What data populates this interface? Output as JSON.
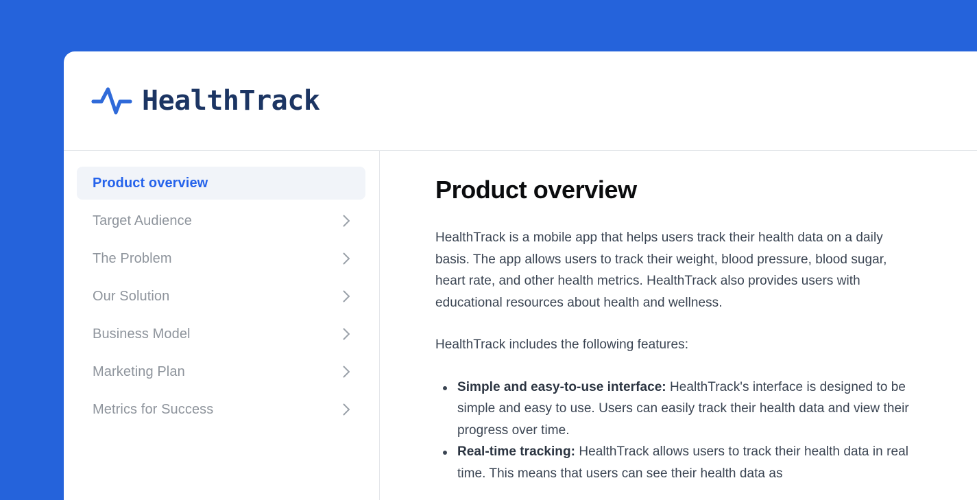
{
  "brand": {
    "name": "HealthTrack",
    "icon": "pulse-heartbeat-icon",
    "icon_color": "#2f6ad9",
    "text_color": "#1c3563"
  },
  "theme": {
    "page_background": "#2563db",
    "card_background": "#ffffff",
    "accent": "#2563eb",
    "active_item_background": "#f1f4f9",
    "divider": "#e3e6ea",
    "muted_text": "#8e949c",
    "body_text": "#3a4452"
  },
  "sidebar": {
    "items": [
      {
        "label": "Product overview",
        "active": true,
        "has_chevron": false
      },
      {
        "label": "Target Audience",
        "active": false,
        "has_chevron": true
      },
      {
        "label": "The Problem",
        "active": false,
        "has_chevron": true
      },
      {
        "label": "Our Solution",
        "active": false,
        "has_chevron": true
      },
      {
        "label": "Business Model",
        "active": false,
        "has_chevron": true
      },
      {
        "label": "Marketing Plan",
        "active": false,
        "has_chevron": true
      },
      {
        "label": "Metrics for Success",
        "active": false,
        "has_chevron": true
      }
    ]
  },
  "main": {
    "title": "Product overview",
    "paragraph_1": "HealthTrack is a mobile app that helps users track their health data on a daily basis. The app allows users to track their weight, blood pressure, blood sugar, heart rate, and other health metrics. HealthTrack also provides users with educational resources about health and wellness.",
    "paragraph_2": "HealthTrack includes the following features:",
    "features": [
      {
        "term": "Simple and easy-to-use interface:",
        "description": " HealthTrack's interface is designed to be simple and easy to use. Users can easily track their health data and view their progress over time."
      },
      {
        "term": "Real-time tracking:",
        "description": " HealthTrack allows users to track their health data in real time. This means that users can see their health data as"
      }
    ]
  }
}
